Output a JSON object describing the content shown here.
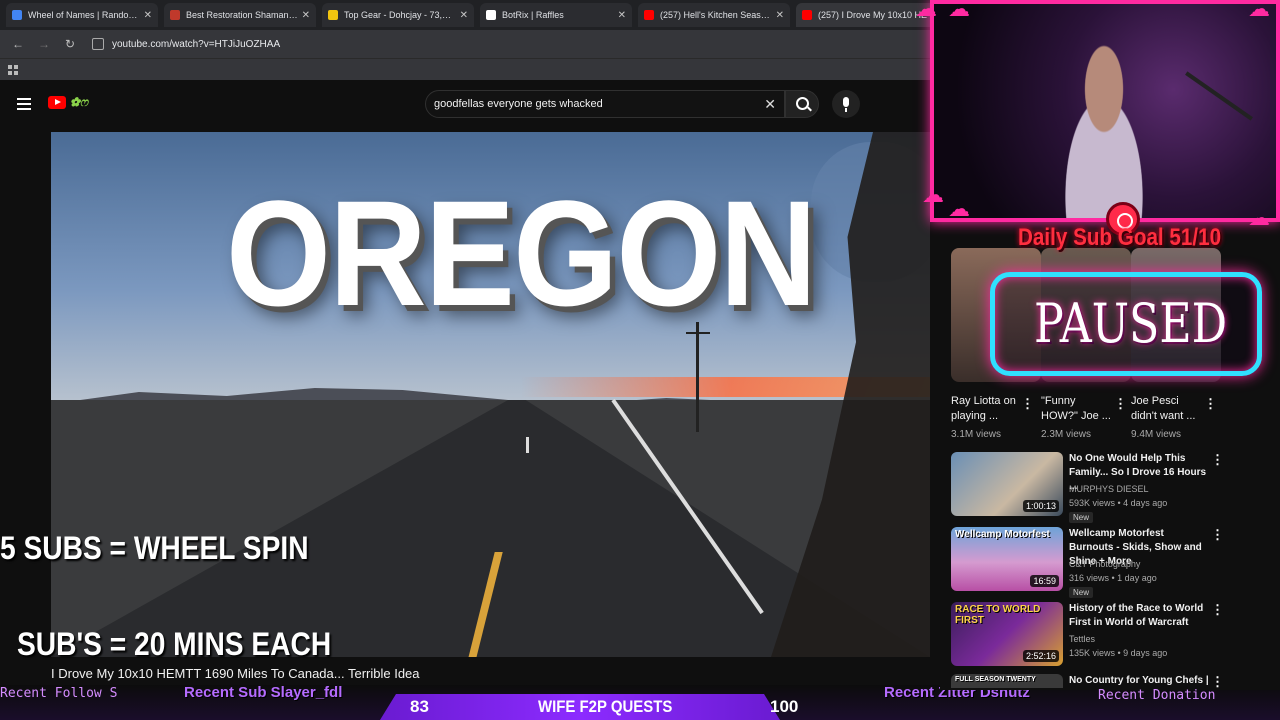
{
  "browser": {
    "tabs": [
      {
        "title": "Wheel of Names | Random nam",
        "color": "#4285f4"
      },
      {
        "title": "Best Restoration Shaman Talent",
        "color": "#c0392b"
      },
      {
        "title": "Top Gear - Dohcjay - 73,000 DP",
        "color": "#f1c40f"
      },
      {
        "title": "BotRix | Raffles",
        "color": "#ffffff"
      },
      {
        "title": "(257) Hell's Kitchen Season 18",
        "color": "#ff0000"
      },
      {
        "title": "(257) I Drove My 10x10 HE",
        "color": "#ff0000"
      }
    ],
    "url": "youtube.com/watch?v=HTJiJuOZHAA"
  },
  "youtube": {
    "search_value": "goodfellas everyone gets whacked",
    "video_overlay_title": "OREGON",
    "video_title": "I Drove My 10x10 HEMTT 1690 Miles To Canada... Terrible Idea"
  },
  "stream": {
    "wheel_text": "5 SUBS = WHEEL SPIN",
    "subs_text": "SUB'S = 20 MINS EACH",
    "daily_goal": "Daily Sub Goal 51/10",
    "paused": "PAUSED",
    "ticker_follow": "Recent Follow  S",
    "ticker_sub": "Recent Sub Slayer_fdl",
    "ticker_zitter": "Recent Zitter Dsnutz",
    "ticker_donation": "Recent Donation",
    "quest_left": "83",
    "quest_title": "WIFE F2P QUESTS",
    "quest_right": "100"
  },
  "shorts": [
    {
      "title": "Ray Liotta on playing ...",
      "views": "3.1M views"
    },
    {
      "title": "\"Funny HOW?\" Joe ...",
      "views": "2.3M views"
    },
    {
      "title": "Joe Pesci didn't want ...",
      "views": "9.4M views"
    }
  ],
  "videos": [
    {
      "title": "No One Would Help This Family... So I Drove 16 Hours ...",
      "channel": "MURPHYS DIESEL",
      "meta": "593K views • 4 days ago",
      "badge": "New",
      "duration": "1:00:13",
      "thumb_text": ""
    },
    {
      "title": "Wellcamp Motorfest Burnouts - Skids, Show and Shine + More",
      "channel": "C&T Photography",
      "meta": "316 views • 1 day ago",
      "badge": "New",
      "duration": "16:59",
      "thumb_text": "Wellcamp Motorfest"
    },
    {
      "title": "History of the Race to World First in World of Warcraft",
      "channel": "Tettles",
      "meta": "135K views • 9 days ago",
      "badge": "",
      "duration": "2:52:16",
      "thumb_text": "RACE TO WORLD FIRST"
    },
    {
      "title": "No Country for Young Chefs |",
      "channel": "",
      "meta": "",
      "badge": "",
      "duration": "",
      "thumb_text": "FULL SEASON TWENTY"
    }
  ]
}
